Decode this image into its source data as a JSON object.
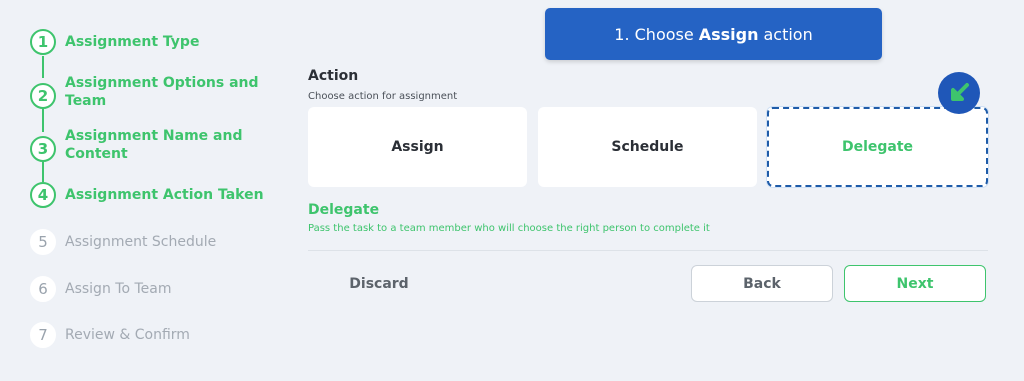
{
  "stepper": {
    "steps": [
      {
        "number": "1",
        "label_lines": [
          "Assignment Type"
        ],
        "status": "done"
      },
      {
        "number": "2",
        "label_lines": [
          "Assignment Options and",
          "Team"
        ],
        "status": "done"
      },
      {
        "number": "3",
        "label_lines": [
          "Assignment Name and",
          "Content"
        ],
        "status": "done"
      },
      {
        "number": "4",
        "label_lines": [
          "Assignment Action Taken"
        ],
        "status": "done"
      },
      {
        "number": "5",
        "label_lines": [
          "Assignment Schedule"
        ],
        "status": "todo"
      },
      {
        "number": "6",
        "label_lines": [
          "Assign To Team"
        ],
        "status": "todo"
      },
      {
        "number": "7",
        "label_lines": [
          "Review & Confirm"
        ],
        "status": "todo"
      }
    ]
  },
  "banner": {
    "prefix": "1. Choose",
    "emphasis": "Assign",
    "suffix": "action"
  },
  "action": {
    "title": "Action",
    "subtitle": "Choose action for assignment",
    "options": [
      {
        "label": "Assign",
        "selected": false
      },
      {
        "label": "Schedule",
        "selected": false
      },
      {
        "label": "Delegate",
        "selected": true
      }
    ],
    "selected_title": "Delegate",
    "selected_description": "Pass the task to a team member who will choose the right person to complete it"
  },
  "buttons": {
    "discard": "Discard",
    "back": "Back",
    "next": "Next"
  },
  "colors": {
    "accent": "#3ec46d",
    "primary": "#2563c4",
    "background": "#eff2f7"
  },
  "icons": {
    "pointer": "arrow-down-left-icon"
  }
}
